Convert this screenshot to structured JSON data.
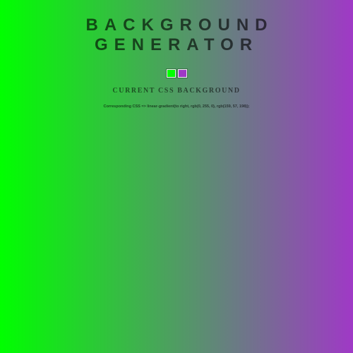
{
  "title": "BACKGROUND GENERATOR",
  "color_pickers": {
    "color1": "#00ff00",
    "color2": "#9f39c6"
  },
  "subtitle": "CURRENT CSS BACKGROUND",
  "css_output": "Corresponding CSS => linear-gradient(to right, rgb(0, 255, 0), rgb(159, 57, 198));",
  "gradient": {
    "direction": "to right",
    "start": "rgb(0, 255, 0)",
    "end": "rgb(159, 57, 198)"
  }
}
